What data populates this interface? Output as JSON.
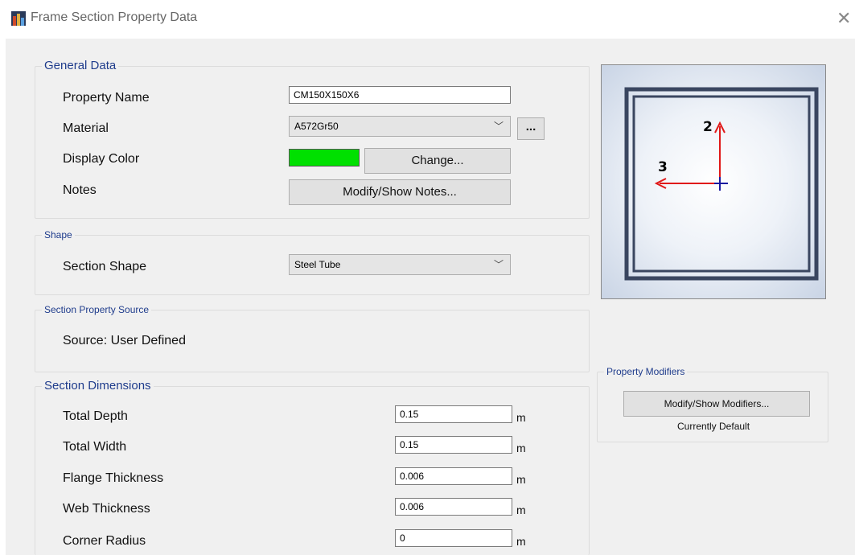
{
  "window": {
    "title": "Frame Section Property Data",
    "close_glyph": "✕"
  },
  "general_data": {
    "legend": "General Data",
    "property_name_label": "Property Name",
    "property_name_value": "CM150X150X6",
    "material_label": "Material",
    "material_value": "A572Gr50",
    "material_more_button": "...",
    "display_color_label": "Display Color",
    "display_color": "#00e000",
    "change_button": "Change...",
    "notes_label": "Notes",
    "notes_button": "Modify/Show Notes..."
  },
  "shape": {
    "legend": "Shape",
    "section_shape_label": "Section Shape",
    "section_shape_value": "Steel Tube"
  },
  "source": {
    "legend": "Section Property Source",
    "text": "Source:  User Defined"
  },
  "dimensions": {
    "legend": "Section Dimensions",
    "rows": [
      {
        "label": "Total Depth",
        "value": "0.15",
        "unit": "m"
      },
      {
        "label": "Total Width",
        "value": "0.15",
        "unit": "m"
      },
      {
        "label": "Flange Thickness",
        "value": "0.006",
        "unit": "m"
      },
      {
        "label": "Web Thickness",
        "value": "0.006",
        "unit": "m"
      },
      {
        "label": "Corner Radius",
        "value": "0",
        "unit": "m"
      }
    ]
  },
  "preview": {
    "axis_2_label": "2",
    "axis_3_label": "3",
    "axis_color": "#e01818",
    "origin_color": "#1a1aa0"
  },
  "modifiers": {
    "legend": "Property Modifiers",
    "button": "Modify/Show Modifiers...",
    "status": "Currently Default"
  }
}
